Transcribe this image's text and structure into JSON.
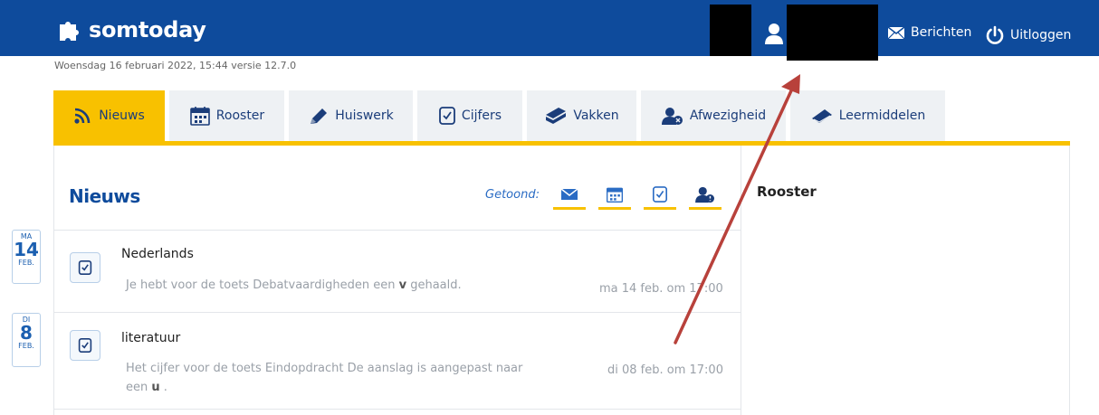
{
  "header": {
    "brand": "somtoday",
    "messages_label": "Berichten",
    "logout_label": "Uitloggen",
    "colors": {
      "primary": "#0e4b9c",
      "accent": "#f8c100"
    }
  },
  "dateline": "Woensdag 16 februari 2022, 15:44 versie 12.7.0",
  "tabs": [
    {
      "label": "Nieuws",
      "icon": "rss-icon",
      "active": true
    },
    {
      "label": "Rooster",
      "icon": "calendar-icon",
      "active": false
    },
    {
      "label": "Huiswerk",
      "icon": "pencil-icon",
      "active": false
    },
    {
      "label": "Cijfers",
      "icon": "grade-check-icon",
      "active": false
    },
    {
      "label": "Vakken",
      "icon": "books-icon",
      "active": false
    },
    {
      "label": "Afwezigheid",
      "icon": "absence-user-icon",
      "active": false
    },
    {
      "label": "Leermiddelen",
      "icon": "book-icon",
      "active": false
    }
  ],
  "news": {
    "title": "Nieuws",
    "filter_label": "Getoond:",
    "filters": [
      "mail-icon",
      "calendar-icon",
      "grade-check-icon",
      "absence-user-icon"
    ],
    "items": [
      {
        "day": "MA",
        "date": "14",
        "month": "FEB.",
        "subject": "Nederlands",
        "text_before": "Je hebt voor de toets Debatvaardigheden een ",
        "grade": "v",
        "text_after": " gehaald.",
        "time": "ma 14 feb. om 17:00"
      },
      {
        "day": "DI",
        "date": "8",
        "month": "FEB.",
        "subject": "literatuur",
        "text_line1": "Het cijfer voor de toets Eindopdracht De aanslag is aangepast naar",
        "text_line2_before": "een ",
        "grade": "u",
        "text_line2_after": " .",
        "time": "di 08 feb. om 17:00"
      }
    ]
  },
  "sidebar": {
    "title": "Rooster"
  }
}
